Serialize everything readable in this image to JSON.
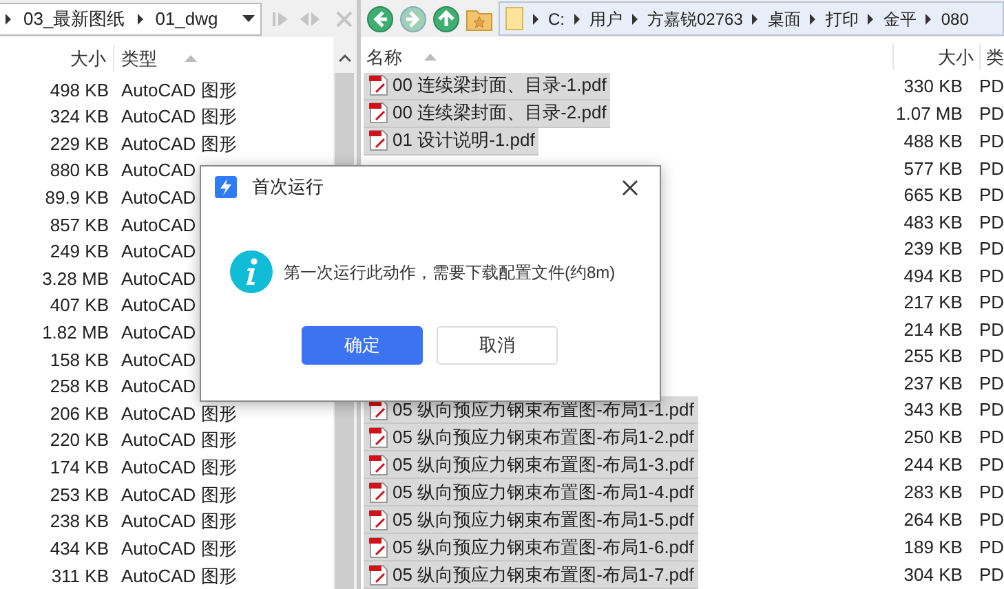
{
  "left_pane": {
    "breadcrumb": [
      "03_最新图纸",
      "01_dwg"
    ],
    "columns": [
      "大小",
      "类型"
    ],
    "rows": [
      {
        "size": "498 KB",
        "type": "AutoCAD 图形"
      },
      {
        "size": "324 KB",
        "type": "AutoCAD 图形"
      },
      {
        "size": "229 KB",
        "type": "AutoCAD 图形"
      },
      {
        "size": "880 KB",
        "type": "AutoCAD"
      },
      {
        "size": "89.9 KB",
        "type": "AutoCAD"
      },
      {
        "size": "857 KB",
        "type": "AutoCAD"
      },
      {
        "size": "249 KB",
        "type": "AutoCAD"
      },
      {
        "size": "3.28 MB",
        "type": "AutoCAD"
      },
      {
        "size": "407 KB",
        "type": "AutoCAD"
      },
      {
        "size": "1.82 MB",
        "type": "AutoCAD"
      },
      {
        "size": "158 KB",
        "type": "AutoCAD"
      },
      {
        "size": "258 KB",
        "type": "AutoCAD"
      },
      {
        "size": "206 KB",
        "type": "AutoCAD 图形"
      },
      {
        "size": "220 KB",
        "type": "AutoCAD 图形"
      },
      {
        "size": "174 KB",
        "type": "AutoCAD 图形"
      },
      {
        "size": "253 KB",
        "type": "AutoCAD 图形"
      },
      {
        "size": "238 KB",
        "type": "AutoCAD 图形"
      },
      {
        "size": "434 KB",
        "type": "AutoCAD 图形"
      },
      {
        "size": "311 KB",
        "type": "AutoCAD 图形"
      }
    ]
  },
  "right_pane": {
    "breadcrumb": [
      "C:",
      "用户",
      "方嘉锐02763",
      "桌面",
      "打印",
      "金平",
      "080"
    ],
    "columns": [
      "名称",
      "大小",
      "类"
    ],
    "rows": [
      {
        "name": "00 连续梁封面、目录-1.pdf",
        "size": "330 KB",
        "type": "PD",
        "selected": true
      },
      {
        "name": "00 连续梁封面、目录-2.pdf",
        "size": "1.07 MB",
        "type": "PD",
        "selected": true
      },
      {
        "name": "01 设计说明-1.pdf",
        "size": "488 KB",
        "type": "PD",
        "selected": true
      },
      {
        "size": "577 KB",
        "type": "PD"
      },
      {
        "size": "665 KB",
        "type": "PD"
      },
      {
        "size": "483 KB",
        "type": "PD"
      },
      {
        "size": "239 KB",
        "type": "PD"
      },
      {
        "size": "494 KB",
        "type": "PD"
      },
      {
        "size": "217 KB",
        "type": "PD"
      },
      {
        "size": "214 KB",
        "type": "PD"
      },
      {
        "size": "255 KB",
        "type": "PD"
      },
      {
        "size": "237 KB",
        "type": "PD"
      },
      {
        "name": "05 纵向预应力钢束布置图-布局1-1.pdf",
        "size": "343 KB",
        "type": "PD",
        "selected": true
      },
      {
        "name": "05 纵向预应力钢束布置图-布局1-2.pdf",
        "size": "250 KB",
        "type": "PD",
        "selected": true
      },
      {
        "name": "05 纵向预应力钢束布置图-布局1-3.pdf",
        "size": "244 KB",
        "type": "PD",
        "selected": true
      },
      {
        "name": "05 纵向预应力钢束布置图-布局1-4.pdf",
        "size": "283 KB",
        "type": "PD",
        "selected": true
      },
      {
        "name": "05 纵向预应力钢束布置图-布局1-5.pdf",
        "size": "264 KB",
        "type": "PD",
        "selected": true
      },
      {
        "name": "05 纵向预应力钢束布置图-布局1-6.pdf",
        "size": "189 KB",
        "type": "PD",
        "selected": true
      },
      {
        "name": "05 纵向预应力钢束布置图-布局1-7.pdf",
        "size": "304 KB",
        "type": "PD",
        "selected": true
      }
    ]
  },
  "dialog": {
    "title": "首次运行",
    "message": "第一次运行此动作，需要下载配置文件(约8m)",
    "buttons": [
      {
        "label": "确定",
        "kind": "primary"
      },
      {
        "label": "取消",
        "kind": "secondary"
      }
    ]
  }
}
